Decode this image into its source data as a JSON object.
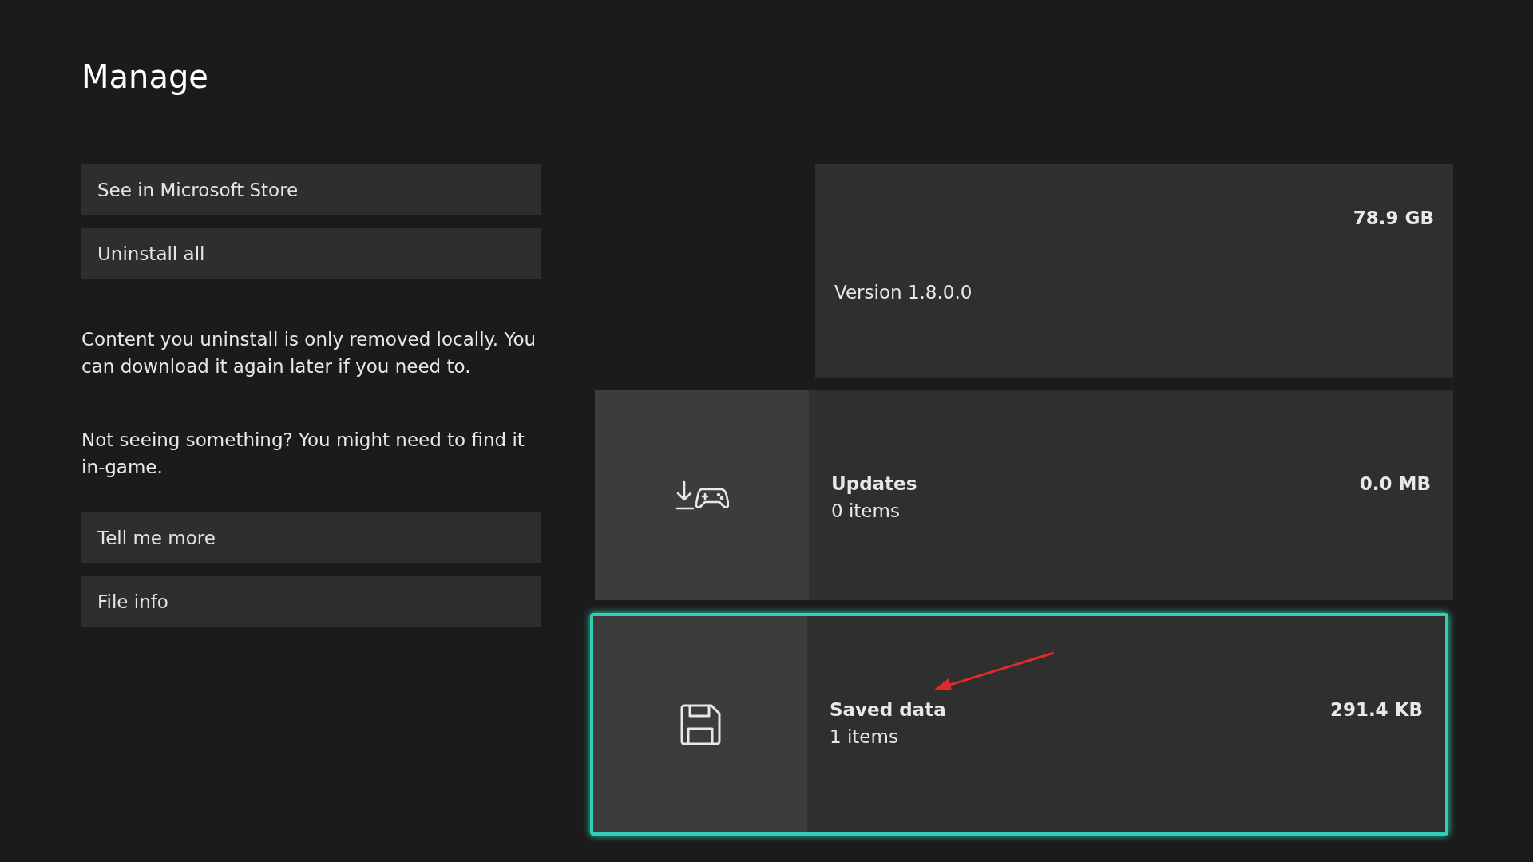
{
  "page": {
    "title": "Manage"
  },
  "left_panel": [
    {
      "kind": "button",
      "text": "See in Microsoft Store"
    },
    {
      "kind": "button",
      "text": "Uninstall all"
    },
    {
      "kind": "note",
      "text": "Content you uninstall is only removed locally. You can download it again later if you need to."
    },
    {
      "kind": "note",
      "text": "Not seeing something? You might need to find it in-game."
    },
    {
      "kind": "button",
      "text": "Tell me more"
    },
    {
      "kind": "button",
      "text": "File info"
    }
  ],
  "cards": [
    {
      "kind": "version",
      "size": "78.9 GB",
      "label": "Version 1.8.0.0",
      "selected": false
    },
    {
      "kind": "updates",
      "title": "Updates",
      "subtitle": "0 items",
      "size": "0.0 MB",
      "selected": false
    },
    {
      "kind": "saved_data",
      "title": "Saved data",
      "subtitle": "1 items",
      "size": "291.4 KB",
      "selected": true
    }
  ]
}
